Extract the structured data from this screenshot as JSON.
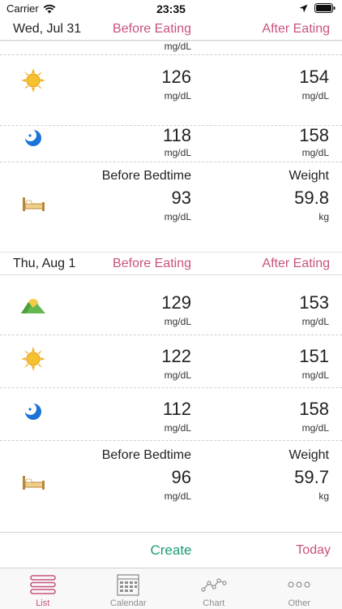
{
  "status_bar": {
    "carrier": "Carrier",
    "time": "23:35"
  },
  "day_jul31": {
    "date": "Wed, Jul 31",
    "before_label": "Before Eating",
    "after_label": "After Eating",
    "partial_unit": "mg/dL",
    "lunch": {
      "icon": "sun-icon",
      "before": "126",
      "before_unit": "mg/dL",
      "after": "154",
      "after_unit": "mg/dL"
    },
    "dinner": {
      "icon": "moon-icon",
      "before": "118",
      "before_unit": "mg/dL",
      "after": "158",
      "after_unit": "mg/dL"
    },
    "bedtime": {
      "icon": "bed-icon",
      "label": "Before Bedtime",
      "value": "93",
      "unit": "mg/dL",
      "weight_label": "Weight",
      "weight": "59.8",
      "weight_unit": "kg"
    }
  },
  "day_aug1": {
    "date": "Thu, Aug 1",
    "before_label": "Before Eating",
    "after_label": "After Eating",
    "breakfast": {
      "icon": "sunrise-mountain-icon",
      "before": "129",
      "before_unit": "mg/dL",
      "after": "153",
      "after_unit": "mg/dL"
    },
    "lunch": {
      "icon": "sun-icon",
      "before": "122",
      "before_unit": "mg/dL",
      "after": "151",
      "after_unit": "mg/dL"
    },
    "dinner": {
      "icon": "moon-icon",
      "before": "112",
      "before_unit": "mg/dL",
      "after": "158",
      "after_unit": "mg/dL"
    },
    "bedtime": {
      "icon": "bed-icon",
      "label": "Before Bedtime",
      "value": "96",
      "unit": "mg/dL",
      "weight_label": "Weight",
      "weight": "59.7",
      "weight_unit": "kg"
    }
  },
  "actions": {
    "create": "Create",
    "today": "Today"
  },
  "tabs": [
    {
      "label": "List",
      "icon": "list-icon",
      "active": true
    },
    {
      "label": "Calendar",
      "icon": "calendar-icon",
      "active": false
    },
    {
      "label": "Chart",
      "icon": "chart-icon",
      "active": false
    },
    {
      "label": "Other",
      "icon": "more-icon",
      "active": false
    }
  ],
  "colors": {
    "accent_pink": "#c8527f",
    "accent_green": "#1e9a78"
  }
}
